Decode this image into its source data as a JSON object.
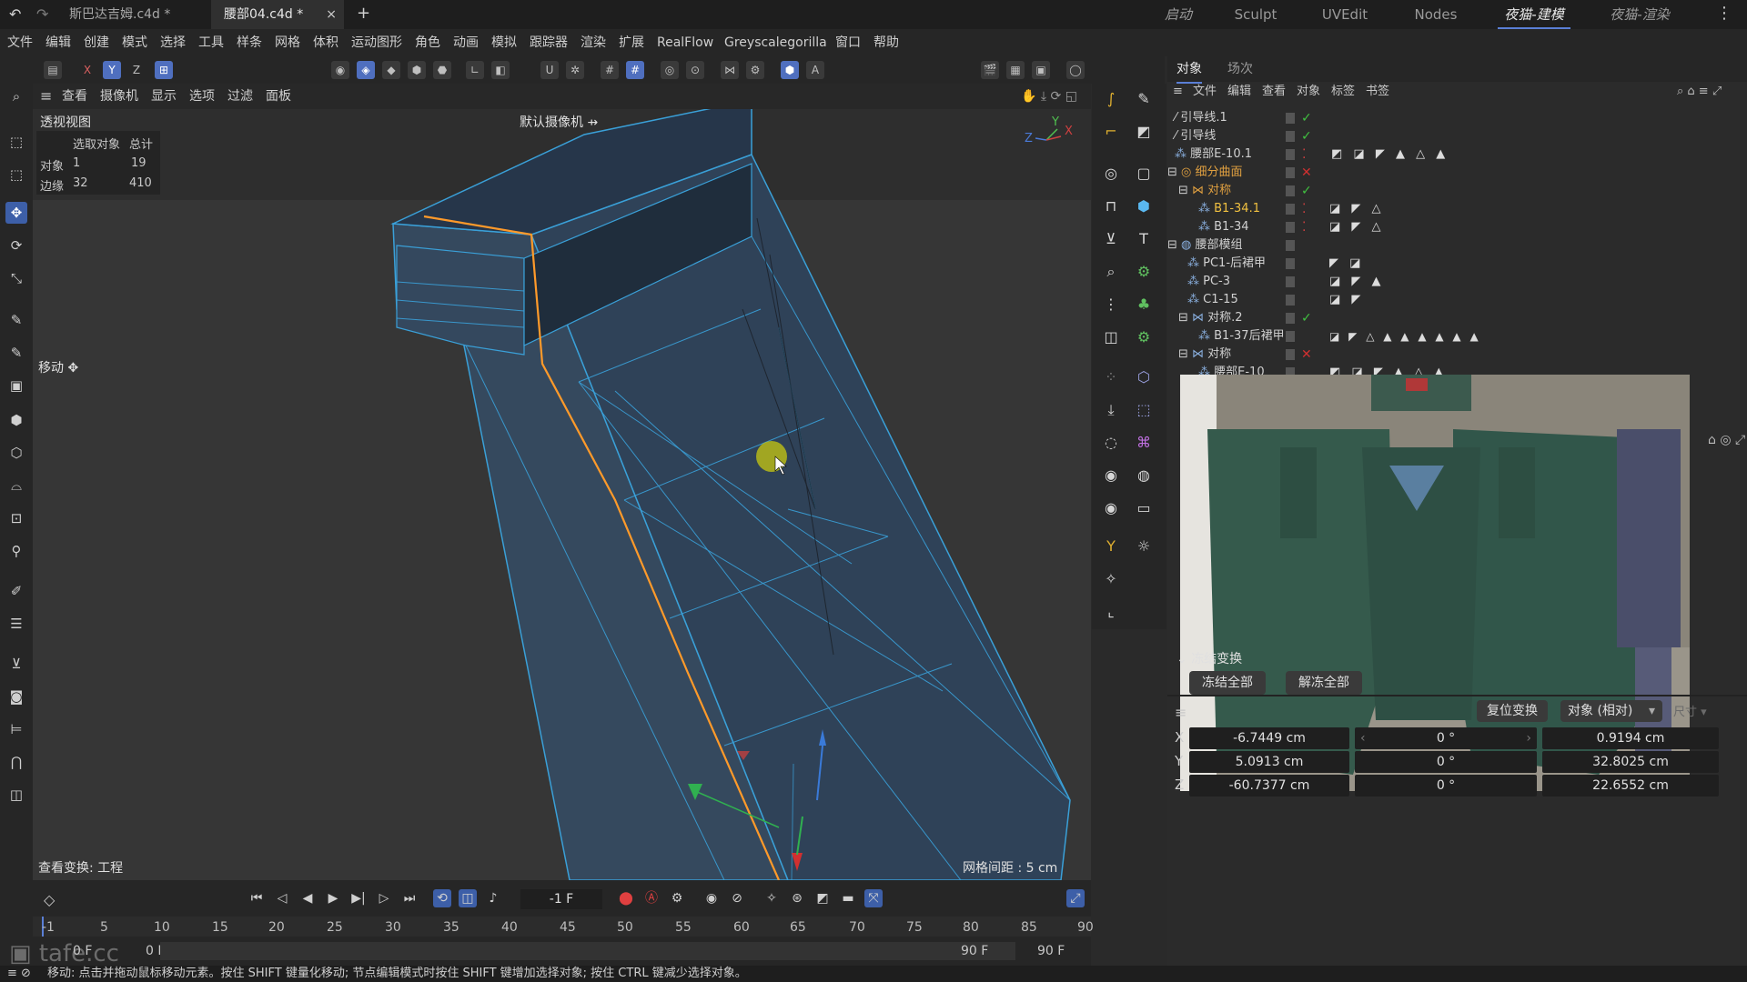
{
  "tabs": [
    "斯巴达吉姆.c4d *",
    "腰部04.c4d *"
  ],
  "layouts": [
    "启动",
    "Sculpt",
    "UVEdit",
    "Nodes",
    "夜猫-建模",
    "夜猫-渲染"
  ],
  "menu": [
    "文件",
    "编辑",
    "创建",
    "模式",
    "选择",
    "工具",
    "样条",
    "网格",
    "体积",
    "运动图形",
    "角色",
    "动画",
    "模拟",
    "跟踪器",
    "渲染",
    "扩展",
    "RealFlow",
    "Greyscalegorilla",
    "窗口",
    "帮助"
  ],
  "toolbar": {
    "x": "X",
    "y": "Y",
    "z": "Z"
  },
  "viewport": {
    "menu": [
      "查看",
      "摄像机",
      "显示",
      "选项",
      "过滤",
      "面板"
    ],
    "title": "透视视图",
    "camera": "默认摄像机",
    "stats_header": [
      "选取对象",
      "总计"
    ],
    "stats": [
      {
        "label": "对象",
        "sel": "1",
        "total": "19"
      },
      {
        "label": "边缘",
        "sel": "32",
        "total": "410"
      }
    ],
    "tool_label": "移动",
    "transform_label": "查看变换: 工程",
    "grid_label": "网格间距 : 5 cm"
  },
  "panel": {
    "tabs": [
      "对象",
      "场次"
    ],
    "menu": [
      "文件",
      "编辑",
      "查看",
      "对象",
      "标签",
      "书签"
    ]
  },
  "objects": [
    {
      "name": "引导线.1",
      "indent": 0,
      "status": "check"
    },
    {
      "name": "引导线",
      "indent": 0,
      "status": "check"
    },
    {
      "name": "腰部E-10.1",
      "indent": 0,
      "status": "dot",
      "tags": "◩ ◪ ◤ ▲ △ ▲"
    },
    {
      "name": "细分曲面",
      "indent": 0,
      "status": "cross",
      "color": "#e0a040"
    },
    {
      "name": "对称",
      "indent": 1,
      "status": "check",
      "color": "#e0a040"
    },
    {
      "name": "B1-34.1",
      "indent": 2,
      "status": "dot",
      "color": "#f0c040",
      "tags": "◪ ◤ △"
    },
    {
      "name": "B1-34",
      "indent": 2,
      "status": "dot",
      "tags": "◪ ◤ △"
    },
    {
      "name": "腰部模组",
      "indent": 0,
      "status": ""
    },
    {
      "name": "PC1-后裙甲",
      "indent": 1,
      "status": "",
      "tags": "◤ ◪"
    },
    {
      "name": "PC-3",
      "indent": 1,
      "status": "",
      "tags": "◪ ◤ ▲"
    },
    {
      "name": "C1-15",
      "indent": 1,
      "status": "",
      "tags": "◪ ◤"
    },
    {
      "name": "对称.2",
      "indent": 1,
      "status": "check"
    },
    {
      "name": "B1-37后裙甲",
      "indent": 2,
      "status": "",
      "tags": "◪ ◤ △ ▲ ▲ ▲ ▲ ▲ ▲"
    },
    {
      "name": "对称",
      "indent": 1,
      "status": "cross"
    },
    {
      "name": "腰部E-10",
      "indent": 2,
      "status": "",
      "tags": "◩ ◪ ◤ ▲ △ ▲"
    }
  ],
  "freeze": {
    "title": "冻结变换",
    "freeze_all": "冻结全部",
    "unfreeze_all": "解冻全部"
  },
  "coords": {
    "reset": "复位变换",
    "mode": "对象 (相对)",
    "size_label": "尺寸",
    "rows": [
      {
        "axis": "X",
        "pos": "-6.7449 cm",
        "rot": "0 °",
        "size": "0.9194 cm"
      },
      {
        "axis": "Y",
        "pos": "5.0913 cm",
        "rot": "0 °",
        "size": "32.8025 cm"
      },
      {
        "axis": "Z",
        "pos": "-60.7377 cm",
        "rot": "0 °",
        "size": "22.6552 cm"
      }
    ]
  },
  "timeline": {
    "frame": "-1 F",
    "ticks": [
      "-1",
      "5",
      "10",
      "15",
      "20",
      "25",
      "30",
      "35",
      "40",
      "45",
      "50",
      "55",
      "60",
      "65",
      "70",
      "75",
      "80",
      "85",
      "90"
    ],
    "start": "0 F",
    "start2": "0 F",
    "end": "90 F",
    "end2": "90 F"
  },
  "status": "移动: 点击并拖动鼠标移动元素。按住 SHIFT 键量化移动; 节点编辑模式时按住 SHIFT 键增加选择对象; 按住 CTRL 键减少选择对象。",
  "watermark": "tafe.cc",
  "colors": {
    "accent": "#5a7fd6",
    "selected_edge": "#ff9a2a",
    "mesh_wire": "#3aa0d8"
  }
}
